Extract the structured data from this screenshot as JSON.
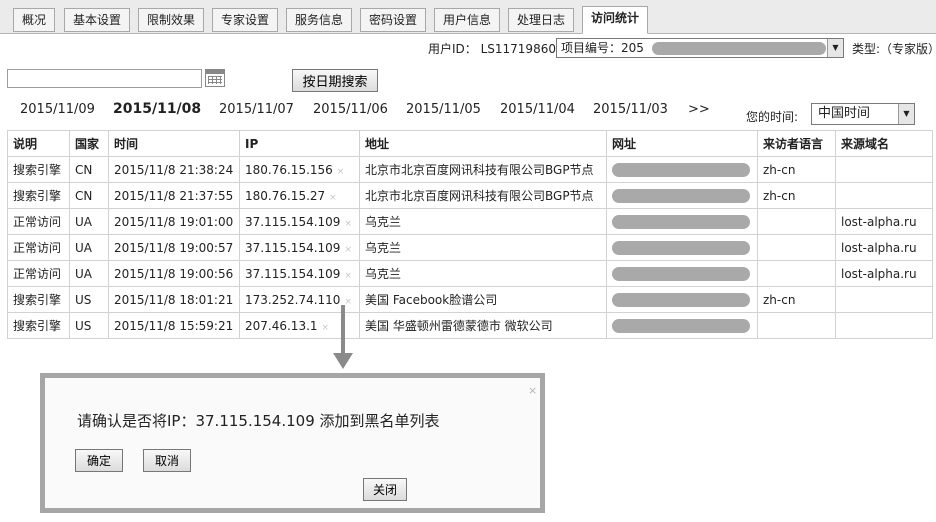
{
  "tabs": [
    {
      "label": "概况"
    },
    {
      "label": "基本设置"
    },
    {
      "label": "限制效果"
    },
    {
      "label": "专家设置"
    },
    {
      "label": "服务信息"
    },
    {
      "label": "密码设置"
    },
    {
      "label": "用户信息"
    },
    {
      "label": "处理日志"
    },
    {
      "label": "访问统计",
      "active": true
    }
  ],
  "account": {
    "user_id_text": "用户ID： LS11719860",
    "project_label": "项目编号：205",
    "type_text": "类型:（专家版）"
  },
  "search": {
    "date_value": "",
    "button_label": "按日期搜索"
  },
  "dates": [
    "2015/11/09",
    "2015/11/08",
    "2015/11/07",
    "2015/11/06",
    "2015/11/05",
    "2015/11/04",
    "2015/11/03"
  ],
  "current_date": "2015/11/08",
  "next_label": ">>",
  "timezone": {
    "label": "您的时间:",
    "value": "中国时间"
  },
  "table": {
    "headers": [
      "说明",
      "国家",
      "时间",
      "IP",
      "地址",
      "网址",
      "来访者语言",
      "来源域名"
    ],
    "rows": [
      {
        "desc": "搜索引擎",
        "country": "CN",
        "time": "2015/11/8 21:38:24",
        "ip": "180.76.15.156",
        "address": "北京市北京百度网讯科技有限公司BGP节点",
        "lang": "zh-cn",
        "source": ""
      },
      {
        "desc": "搜索引擎",
        "country": "CN",
        "time": "2015/11/8 21:37:55",
        "ip": "180.76.15.27",
        "address": "北京市北京百度网讯科技有限公司BGP节点",
        "lang": "zh-cn",
        "source": ""
      },
      {
        "desc": "正常访问",
        "country": "UA",
        "time": "2015/11/8 19:01:00",
        "ip": "37.115.154.109",
        "address": "乌克兰",
        "lang": "",
        "source": "lost-alpha.ru"
      },
      {
        "desc": "正常访问",
        "country": "UA",
        "time": "2015/11/8 19:00:57",
        "ip": "37.115.154.109",
        "address": "乌克兰",
        "lang": "",
        "source": "lost-alpha.ru"
      },
      {
        "desc": "正常访问",
        "country": "UA",
        "time": "2015/11/8 19:00:56",
        "ip": "37.115.154.109",
        "address": "乌克兰",
        "lang": "",
        "source": "lost-alpha.ru"
      },
      {
        "desc": "搜索引擎",
        "country": "US",
        "time": "2015/11/8 18:01:21",
        "ip": "173.252.74.110",
        "address": "美国 Facebook脸谱公司",
        "lang": "zh-cn",
        "source": ""
      },
      {
        "desc": "搜索引擎",
        "country": "US",
        "time": "2015/11/8 15:59:21",
        "ip": "207.46.13.1",
        "address": "美国 华盛顿州雷德蒙德市 微软公司",
        "lang": "",
        "source": ""
      }
    ]
  },
  "row_delete_mark": "×",
  "dialog": {
    "message": "请确认是否将IP：37.115.154.109 添加到黑名单列表",
    "confirm_label": "确定",
    "cancel_label": "取消",
    "close_label": "关闭",
    "close_mark": "×"
  },
  "colors": {
    "tabbar_bg": "#ebebeb",
    "dialog_border": "#a6a6a6",
    "redaction": "#a9a9a9",
    "arrow": "#8a8a8a"
  },
  "icons": {
    "calendar": "calendar-icon",
    "dropdown": "chevron-down-icon",
    "arrow": "arrow-down-icon"
  }
}
